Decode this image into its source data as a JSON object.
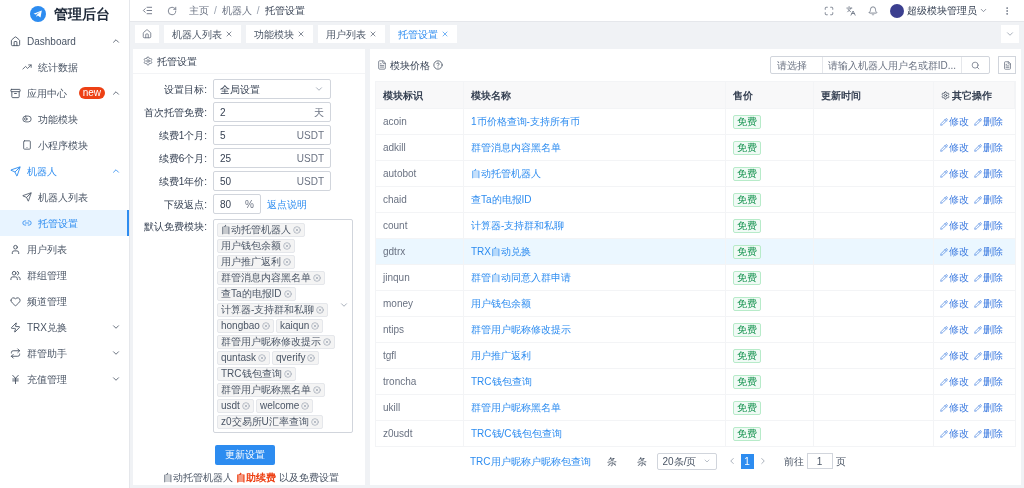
{
  "app": {
    "title": "管理后台"
  },
  "sidebar": {
    "items": [
      {
        "label": "Dashboard",
        "expanded": true,
        "children": [
          {
            "label": "统计数据",
            "selected": false
          }
        ]
      },
      {
        "label": "应用中心",
        "badge": "new",
        "expanded": true,
        "children": [
          {
            "label": "功能模块",
            "selected": false
          },
          {
            "label": "小程序模块",
            "selected": false
          }
        ]
      },
      {
        "label": "机器人",
        "expanded": true,
        "children": [
          {
            "label": "机器人列表",
            "selected": false
          },
          {
            "label": "托管设置",
            "selected": true
          }
        ]
      },
      {
        "label": "用户列表"
      },
      {
        "label": "群组管理"
      },
      {
        "label": "频道管理"
      },
      {
        "label": "TRX兑换",
        "expanded": false
      },
      {
        "label": "群管助手",
        "expanded": false
      },
      {
        "label": "充值管理",
        "expanded": false
      }
    ]
  },
  "header": {
    "breadcrumb": [
      "主页",
      "机器人",
      "托管设置"
    ],
    "separator": "/",
    "user": "超级模块管理员"
  },
  "tabs": [
    {
      "label": "机器人列表",
      "selected": false
    },
    {
      "label": "功能模块",
      "selected": false
    },
    {
      "label": "用户列表",
      "selected": false
    },
    {
      "label": "托管设置",
      "selected": true
    }
  ],
  "settings": {
    "title": "托管设置",
    "fields": [
      {
        "kind": "select",
        "label": "设置目标:",
        "value": "全局设置"
      },
      {
        "kind": "input",
        "label": "首次托管免费:",
        "value": "2",
        "suffix": "天"
      },
      {
        "kind": "input",
        "label": "续费1个月:",
        "value": "5",
        "suffix": "USDT"
      },
      {
        "kind": "input",
        "label": "续费6个月:",
        "value": "25",
        "suffix": "USDT"
      },
      {
        "kind": "input",
        "label": "续费1年价:",
        "value": "50",
        "suffix": "USDT"
      },
      {
        "kind": "short",
        "label": "下级返点:",
        "value": "80",
        "suffix": "%",
        "link": "返点说明"
      },
      {
        "kind": "tags",
        "label": "默认免费模块:",
        "tags": [
          "自动托管机器人",
          "用户钱包余额",
          "用户推广返利",
          "群管消息内容黑名单",
          "查Ta的电报ID",
          "计算器-支持群和私聊",
          "hongbao",
          "kaiqun",
          "群管用户昵称修改提示",
          "quntask",
          "qverify",
          "TRC钱包查询",
          "群管用户昵称黑名单",
          "usdt",
          "welcome",
          "z0交易所U汇率查询"
        ]
      }
    ],
    "button": "更新设置",
    "note": {
      "before": "自动托管机器人",
      "highlight": "自助续费",
      "after": "以及免费设置"
    }
  },
  "modules": {
    "title": "模块价格",
    "search": {
      "select_placeholder": "请选择",
      "placeholder": "请输入机器人用户名或群ID..."
    },
    "columns": [
      "模块标识",
      "模块名称",
      "售价",
      "更新时间",
      "其它操作"
    ],
    "rows": [
      {
        "id": "acoin",
        "name": "1币价格查询-支持所有币",
        "price": "免费",
        "actions": [
          "修改",
          "删除"
        ],
        "hovered": false
      },
      {
        "id": "adkill",
        "name": "群管消息内容黑名单",
        "price": "免费",
        "actions": [
          "修改",
          "删除"
        ],
        "hovered": false
      },
      {
        "id": "autobot",
        "name": "自动托管机器人",
        "price": "免费",
        "actions": [
          "修改",
          "删除"
        ],
        "hovered": false
      },
      {
        "id": "chaid",
        "name": "查Ta的电报ID",
        "price": "免费",
        "actions": [
          "修改",
          "删除"
        ],
        "hovered": false
      },
      {
        "id": "count",
        "name": "计算器-支持群和私聊",
        "price": "免费",
        "actions": [
          "修改",
          "删除"
        ],
        "hovered": false
      },
      {
        "id": "gdtrx",
        "name": "TRX自动兑换",
        "price": "免费",
        "actions": [
          "修改",
          "删除"
        ],
        "hovered": true
      },
      {
        "id": "jinqun",
        "name": "群管自动同意入群申请",
        "price": "免费",
        "actions": [
          "修改",
          "删除"
        ],
        "hovered": false
      },
      {
        "id": "money",
        "name": "用户钱包余额",
        "price": "免费",
        "actions": [
          "修改",
          "删除"
        ],
        "hovered": false
      },
      {
        "id": "ntips",
        "name": "群管用户昵称修改提示",
        "price": "免费",
        "actions": [
          "修改",
          "删除"
        ],
        "hovered": false
      },
      {
        "id": "tgfl",
        "name": "用户推广返利",
        "price": "免费",
        "actions": [
          "修改",
          "删除"
        ],
        "hovered": false
      },
      {
        "id": "troncha",
        "name": "TRC钱包查询",
        "price": "免费",
        "actions": [
          "修改",
          "删除"
        ],
        "hovered": false
      },
      {
        "id": "ukill",
        "name": "群管用户昵称黑名单",
        "price": "免费",
        "actions": [
          "修改",
          "删除"
        ],
        "hovered": false
      },
      {
        "id": "z0usdt",
        "name": "TRC钱/C钱包包查询",
        "price": "免费",
        "actions": [
          "修改",
          "删除"
        ],
        "hovered": false
      }
    ],
    "partial_row": "TRC用户昵称户昵称包查询",
    "pagination": {
      "total_a": "条",
      "total_b": "条",
      "page_size": "20条/页",
      "pages": [
        {
          "label": "1",
          "selected": true
        }
      ],
      "goto": "前往",
      "goto_value": "1",
      "page_unit": "页"
    }
  }
}
